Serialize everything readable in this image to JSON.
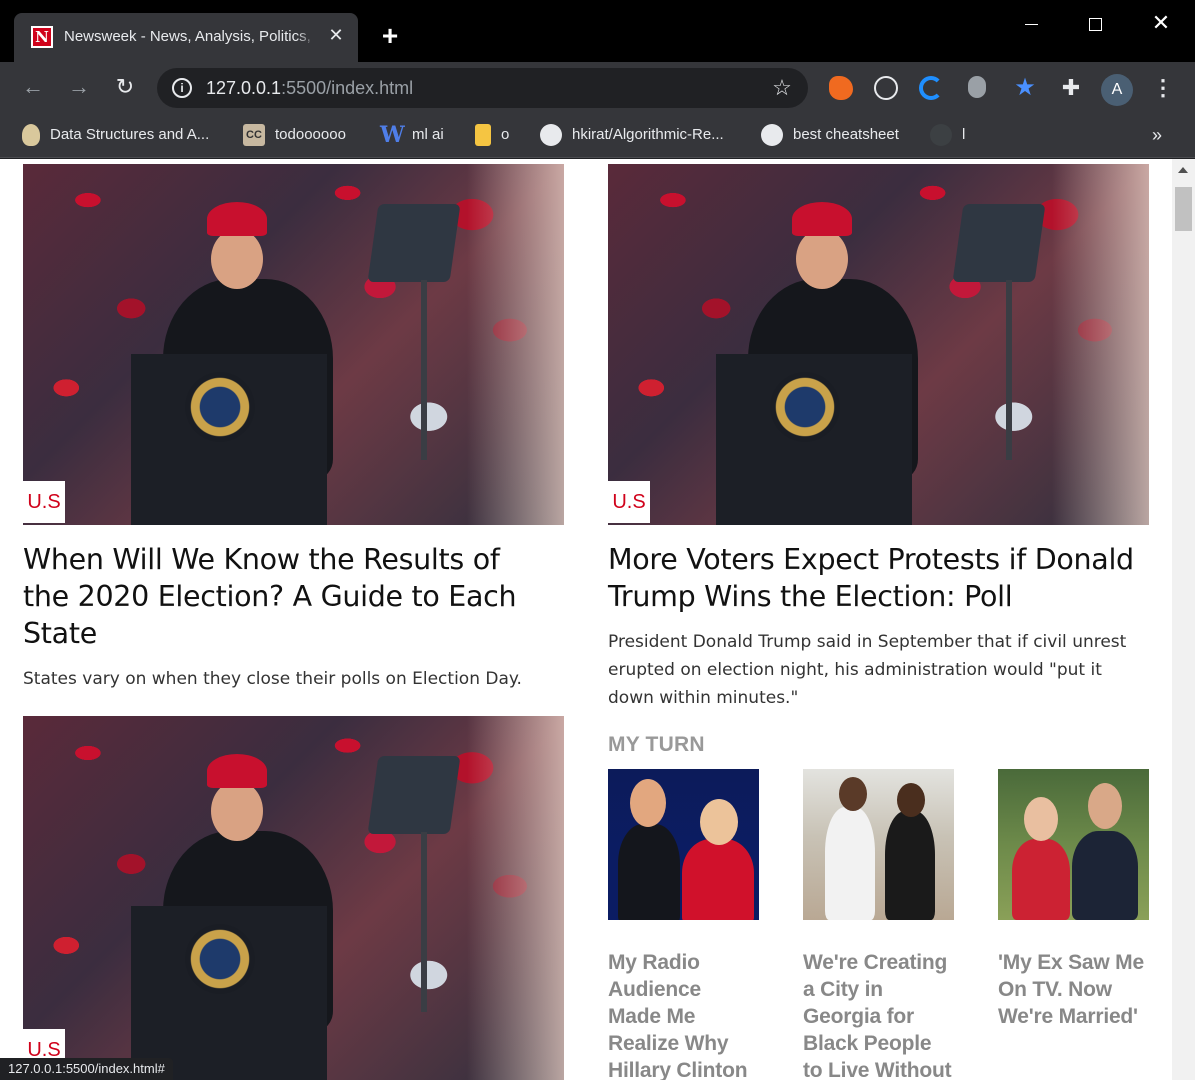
{
  "browser": {
    "tab_title": "Newsweek - News, Analysis, Politics, Business, Technology",
    "favicon_letter": "N",
    "tab_close": "✕",
    "new_tab": "+",
    "url_host": "127.0.0.1",
    "url_rest": ":5500/index.html",
    "avatar_letter": "A",
    "bookmarks": [
      {
        "label": "Data Structures and A...",
        "icon": "bulb-icon"
      },
      {
        "label": "todoooooo",
        "icon": "cc-icon",
        "icon_text": "CC"
      },
      {
        "label": "ml ai",
        "icon": "w-icon",
        "icon_text": "W"
      },
      {
        "label": "o",
        "icon": "folder-icon"
      },
      {
        "label": "hkirat/Algorithmic-Re...",
        "icon": "github-icon"
      },
      {
        "label": "best cheatsheet",
        "icon": "github-icon"
      },
      {
        "label": "l",
        "icon": "github-icon"
      }
    ],
    "bookmarks_more": "»",
    "status_url": "127.0.0.1:5500/index.html#"
  },
  "articles": [
    {
      "tag": "U.S",
      "headline": "When Will We Know the Results of the 2020 Election? A Guide to Each State",
      "dek": "States vary on when they close their polls on Election Day."
    },
    {
      "tag": "U.S",
      "headline": "More Voters Expect Protests if Donald Trump Wins the Election: Poll",
      "dek": "President Donald Trump said in September that if civil unrest erupted on election night, his administration would \"put it down within minutes.\""
    },
    {
      "tag": "U.S"
    }
  ],
  "my_turn": {
    "label": "MY TURN",
    "cards": [
      {
        "title": "My Radio Audience Made Me Realize Why Hillary Clinton Lost"
      },
      {
        "title": "We're Creating a City in Georgia for Black People to Live Without Racism"
      },
      {
        "title": "'My Ex Saw Me On TV. Now We're Married'"
      }
    ]
  },
  "colors": {
    "accent_red": "#d0021b",
    "muted_gray": "#888888"
  }
}
